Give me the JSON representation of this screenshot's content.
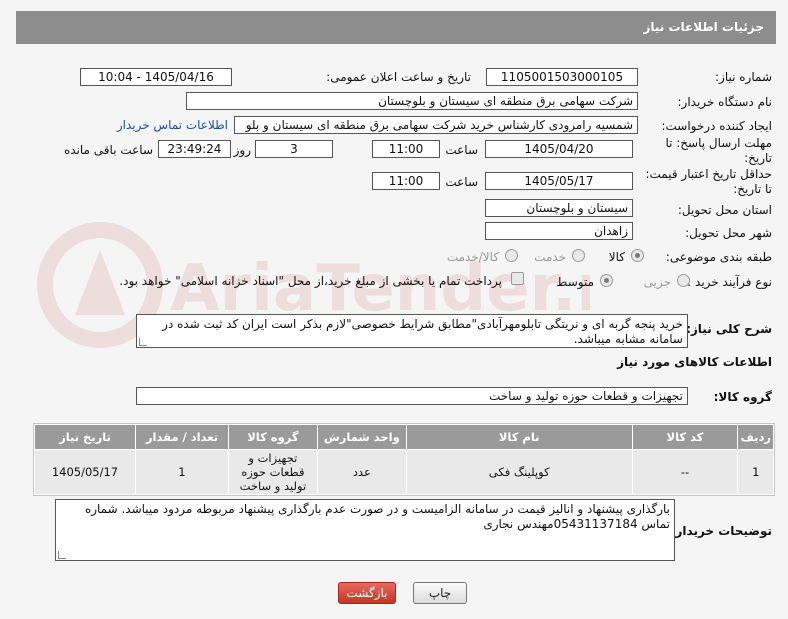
{
  "header": {
    "title": "جزئیات اطلاعات نیاز"
  },
  "fields": {
    "need_number_label": "شماره نیاز:",
    "need_number_value": "1105001503000105",
    "announce_label": "تاریخ و ساعت اعلان عمومی:",
    "announce_value": "1405/04/16 - 10:04",
    "buyer_org_label": "نام دستگاه خریدار:",
    "buyer_org_value": "شرکت سهامی برق منطقه ای سیستان و بلوچستان",
    "requester_label": "ایجاد کننده درخواست:",
    "requester_value": "شمسیه رامرودی کارشناس خرید شرکت سهامی برق منطقه ای سیستان و بلو",
    "buyer_contact_link": "اطلاعات تماس خریدار",
    "deadline_label_1": "مهلت ارسال پاسخ: تا",
    "deadline_label_2": "تاریخ:",
    "deadline_date": "1405/04/20",
    "time_label": "ساعت",
    "deadline_time": "11:00",
    "days_value": "3",
    "days_label": "روز و",
    "remaining_value": "23:49:24",
    "remaining_label": "ساعت باقی مانده",
    "validity_label_1": "حداقل تاریخ اعتبار قیمت:",
    "validity_label_2": "تا تاریخ:",
    "validity_date": "1405/05/17",
    "validity_time": "11:00",
    "province_label": "استان محل تحویل:",
    "province_value": "سیستان و بلوچستان",
    "city_label": "شهر محل تحویل:",
    "city_value": "زاهدان",
    "category_label": "طبقه بندی موضوعی:",
    "category_options": [
      "کالا",
      "خدمت",
      "کالا/خدمت"
    ],
    "purchase_type_label": "نوع فرآیند خرید :",
    "purchase_type_options": [
      "جزیی",
      "متوسط"
    ],
    "payment_note": "پرداخت تمام یا بخشی از مبلغ خرید،از محل \"اسناد خزانه اسلامی\" خواهد بود."
  },
  "description": {
    "label": "شرح کلی نیاز:",
    "value": "خرید پنجه گربه ای و نریتگی تابلومهرآبادی\"مطابق شرایط خصوصی\"لازم بذکر است ایران کد ثبت شده در سامانه مشابه میباشد."
  },
  "goods_section": {
    "title": "اطلاعات کالاهای مورد نیاز"
  },
  "goods_group": {
    "label": "گروه کالا:",
    "value": "تجهیزات و قطعات حوزه تولید و ساخت"
  },
  "table": {
    "columns": [
      "ردیف",
      "کد کالا",
      "نام کالا",
      "واحد شمارش",
      "گروه کالا",
      "تعداد / مقدار",
      "تاریخ نیاز"
    ],
    "rows": [
      [
        "1",
        "--",
        "کوپلینگ فکی",
        "عدد",
        "تجهیزات و قطعات حوزه تولید و ساخت",
        "1",
        "1405/05/17"
      ]
    ]
  },
  "buyer_notes": {
    "label": "توضیحات خریدار:",
    "value": "بارگذاری پیشنهاد و انالیز قیمت در سامانه الزامیست و در صورت عدم بارگذاری پیشنهاد مربوطه مردود میباشد. شماره تماس 05431137184مهندس نجاری"
  },
  "buttons": {
    "back": "بازگشت",
    "print": "چاپ"
  },
  "watermark": {
    "text": "AriaTender.net"
  }
}
